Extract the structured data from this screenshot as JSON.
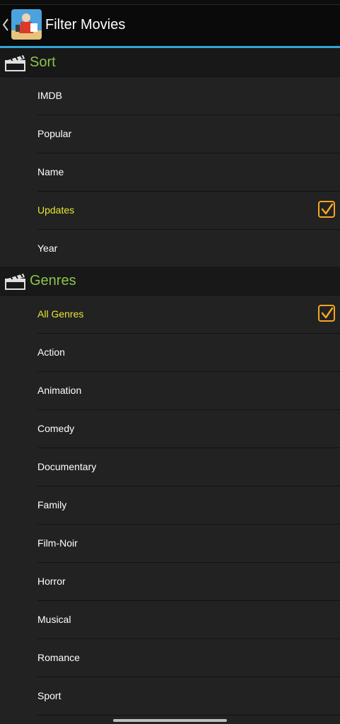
{
  "header": {
    "title": "Filter Movies"
  },
  "sections": {
    "sort": {
      "label": "Sort",
      "items": [
        {
          "label": "IMDB",
          "checked": false
        },
        {
          "label": "Popular",
          "checked": false
        },
        {
          "label": "Name",
          "checked": false
        },
        {
          "label": "Updates",
          "checked": true
        },
        {
          "label": "Year",
          "checked": false
        }
      ]
    },
    "genres": {
      "label": "Genres",
      "items": [
        {
          "label": "All Genres",
          "checked": true
        },
        {
          "label": "Action",
          "checked": false
        },
        {
          "label": "Animation",
          "checked": false
        },
        {
          "label": "Comedy",
          "checked": false
        },
        {
          "label": "Documentary",
          "checked": false
        },
        {
          "label": "Family",
          "checked": false
        },
        {
          "label": "Film-Noir",
          "checked": false
        },
        {
          "label": "Horror",
          "checked": false
        },
        {
          "label": "Musical",
          "checked": false
        },
        {
          "label": "Romance",
          "checked": false
        },
        {
          "label": "Sport",
          "checked": false
        }
      ]
    }
  },
  "colors": {
    "accent_line": "#33a6d6",
    "section_label": "#8bc34a",
    "selected_text": "#e6e635",
    "checkbox": "#f5a623",
    "background": "#222222"
  },
  "icons": {
    "back": "chevron-left-icon",
    "app": "app-logo-icon",
    "section": "clapperboard-icon",
    "check": "checkbox-checked-icon"
  }
}
